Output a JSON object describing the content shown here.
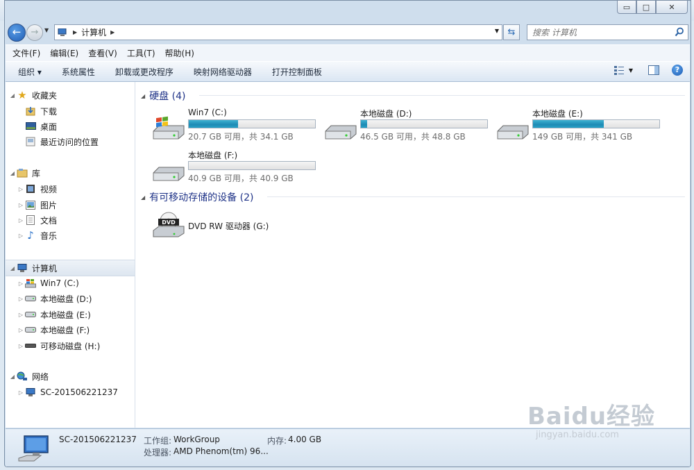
{
  "window": {
    "caption_minimize": "▭",
    "caption_maximize": "□",
    "caption_close": "✕"
  },
  "nav": {
    "back_glyph": "←",
    "forward_glyph": "→",
    "address_crumb": "计算机",
    "search_placeholder": "搜索 计算机"
  },
  "menu": {
    "items": [
      "文件(F)",
      "编辑(E)",
      "查看(V)",
      "工具(T)",
      "帮助(H)"
    ]
  },
  "toolbar": {
    "organize": "组织 ▾",
    "items": [
      "系统属性",
      "卸载或更改程序",
      "映射网络驱动器",
      "打开控制面板"
    ],
    "help": "?"
  },
  "sidebar": {
    "favorites": {
      "label": "收藏夹",
      "items": [
        "下载",
        "桌面",
        "最近访问的位置"
      ]
    },
    "libraries": {
      "label": "库",
      "items": [
        "视频",
        "图片",
        "文档",
        "音乐"
      ]
    },
    "computer": {
      "label": "计算机",
      "items": [
        "Win7 (C:)",
        "本地磁盘 (D:)",
        "本地磁盘 (E:)",
        "本地磁盘 (F:)",
        "可移动磁盘 (H:)"
      ]
    },
    "network": {
      "label": "网络",
      "items": [
        "SC-201506221237"
      ]
    }
  },
  "content": {
    "hdd_group": "硬盘 (4)",
    "removable_group": "有可移动存储的设备 (2)",
    "drives": [
      {
        "name": "Win7 (C:)",
        "size": "20.7 GB 可用，共 34.1 GB",
        "used_fraction": 0.39
      },
      {
        "name": "本地磁盘 (D:)",
        "size": "46.5 GB 可用，共 48.8 GB",
        "used_fraction": 0.05
      },
      {
        "name": "本地磁盘 (E:)",
        "size": "149 GB 可用，共 341 GB",
        "used_fraction": 0.56
      },
      {
        "name": "本地磁盘 (F:)",
        "size": "40.9 GB 可用，共 40.9 GB",
        "used_fraction": 0.0
      }
    ],
    "dvd": {
      "name": "DVD RW 驱动器 (G:)",
      "icon_text": "DVD"
    }
  },
  "details": {
    "pc_name": "SC-201506221237",
    "workgroup_label": "工作组:",
    "workgroup": "WorkGroup",
    "memory_label": "内存:",
    "memory": "4.00 GB",
    "cpu_label": "处理器:",
    "cpu": "AMD Phenom(tm) 96..."
  },
  "watermark": {
    "brand": "Baidu经验",
    "url": "jingyan.baidu.com"
  },
  "colors": {
    "accent": "#1e3287",
    "bar_fill": "#26a0c6",
    "selection": "#dde6f0"
  }
}
